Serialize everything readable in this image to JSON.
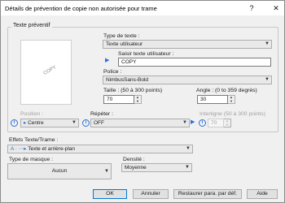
{
  "window": {
    "title": "Détails de prévention de copie non autorisée pour trame",
    "help_glyph": "?",
    "close_glyph": "✕"
  },
  "group_text": {
    "label": "Texte préventif"
  },
  "preview": {
    "watermark": "COPY"
  },
  "text_type": {
    "label": "Type de texte :",
    "value": "Texte utilisateur"
  },
  "user_text": {
    "label": "Saisir texte utilisateur :",
    "value": "COPY"
  },
  "font": {
    "label": "Police :",
    "value": "NimbusSans-Bold"
  },
  "size": {
    "label": "Taille : (50 à 300 points)",
    "value": "70"
  },
  "angle": {
    "label": "Angle : (0 to 359 degrés)",
    "value": "30"
  },
  "position": {
    "label": "Position :",
    "value": "Centre"
  },
  "repeat": {
    "label": "Répéter :",
    "value": "OFF"
  },
  "spacing": {
    "label": "Interligne (50 à 300 points)",
    "value": "70"
  },
  "effects": {
    "label": "Effets Texte/Trame :",
    "value": "Texte et arrière-plan"
  },
  "pattern": {
    "label": "Type de masque :",
    "value": "Aucun"
  },
  "density": {
    "label": "Densité :",
    "value": "Moyenne"
  },
  "buttons": {
    "ok": "OK",
    "cancel": "Annuler",
    "reset": "Restaurer para. par déf.",
    "help": "Aide"
  },
  "colors": {
    "accent": "#0078d7",
    "info": "#2a6fd6",
    "bg": "#f0f0f0"
  }
}
